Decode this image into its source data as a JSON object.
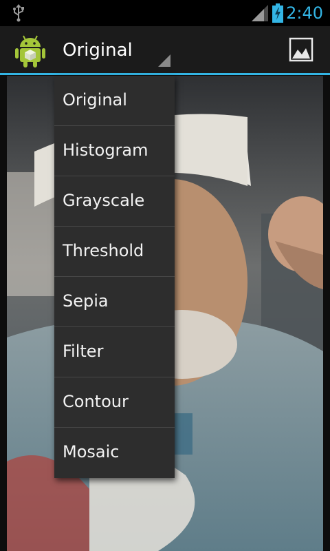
{
  "status_bar": {
    "time": "2:40",
    "icons": [
      "usb-icon",
      "signal-icon",
      "battery-charging-icon"
    ]
  },
  "action_bar": {
    "app_icon": "android-icon",
    "spinner": {
      "selected": "Original"
    },
    "image_action_icon": "image-icon"
  },
  "dropdown": {
    "items": [
      "Original",
      "Histogram",
      "Grayscale",
      "Threshold",
      "Sepia",
      "Filter",
      "Contour",
      "Mosaic"
    ]
  },
  "colors": {
    "accent": "#33b5e5",
    "status_bar": "#000000",
    "action_bar": "#1b1b1b",
    "dropdown_bg": "#2d2d2d",
    "dropdown_divider": "#474747"
  }
}
